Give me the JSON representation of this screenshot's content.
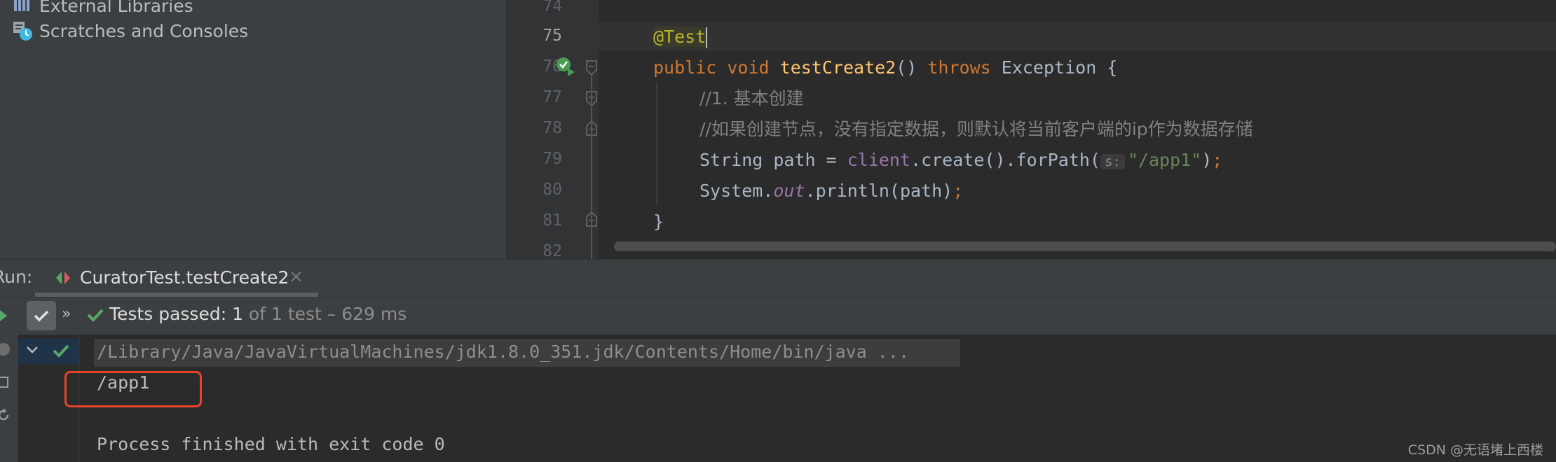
{
  "project_tree": {
    "items": [
      {
        "label": "External Libraries",
        "icon": "library-icon"
      },
      {
        "label": "Scratches and Consoles",
        "icon": "scratches-icon"
      }
    ]
  },
  "editor": {
    "line_numbers": [
      "74",
      "75",
      "76",
      "77",
      "78",
      "79",
      "80",
      "81",
      "82"
    ],
    "current_line": "75",
    "code": {
      "annotation": "@Test",
      "l76_kw1": "public",
      "l76_kw2": "void",
      "l76_method": "testCreate2",
      "l76_paren": "()",
      "l76_throws": "throws",
      "l76_rest": "Exception {",
      "l77_comment": "//1. 基本创建",
      "l78_comment": "//如果创建节点，没有指定数据，则默认将当前客户端的ip作为数据存储",
      "l79_type": "String path = ",
      "l79_field": "client",
      "l79_call": ".create().forPath(",
      "l79_hint": "s:",
      "l79_string": "\"/app1\"",
      "l79_close": ")",
      "l79_semi": ";",
      "l80_pre": "System.",
      "l80_field": "out",
      "l80_call": ".println(path)",
      "l80_semi": ";",
      "l81_brace": "}"
    }
  },
  "run_window": {
    "label": "Run:",
    "tab_label": "CuratorTest.testCreate2",
    "close_glyph": "×",
    "status": {
      "prefix": "Tests passed: ",
      "passed": "1",
      "suffix": " of 1 test – 629 ms"
    },
    "console": {
      "command": "/Library/Java/JavaVirtualMachines/jdk1.8.0_351.jdk/Contents/Home/bin/java ...",
      "output": "/app1",
      "exit": "Process finished with exit code 0"
    }
  },
  "watermark": "CSDN @无语堵上西楼",
  "colors": {
    "pass_green": "#59a869",
    "highlight_red": "#e8442a"
  }
}
